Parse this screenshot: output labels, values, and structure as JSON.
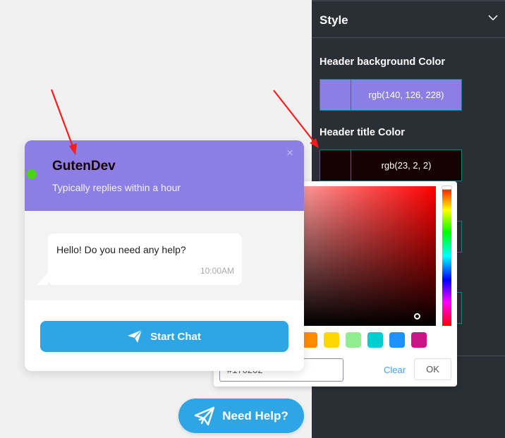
{
  "panel": {
    "title": "Style",
    "fields": [
      {
        "label": "Header background Color",
        "value": "rgb(140, 126, 228)",
        "color": "#8c7ee4"
      },
      {
        "label": "Header title Color",
        "value": "rgb(23, 2, 2)",
        "color": "#170202"
      }
    ]
  },
  "picker": {
    "hue_color": "#ff0000",
    "presets": [
      "#ffd700",
      "#90ee90",
      "#00ced1",
      "#1e90ff",
      "#c71585"
    ],
    "hex_value": "#170202",
    "clear_label": "Clear",
    "ok_label": "OK"
  },
  "chat": {
    "title": "GutenDev",
    "subtitle": "Typically replies within a hour",
    "close_icon": "×",
    "message": "Hello! Do you need any help?",
    "time": "10:00AM",
    "start_label": "Start Chat",
    "colors": {
      "header": "#8c7ee4",
      "title": "#170202",
      "online": "#4cd20e",
      "button": "#2ea6e6"
    }
  },
  "help_button": {
    "label": "Need Help?"
  }
}
